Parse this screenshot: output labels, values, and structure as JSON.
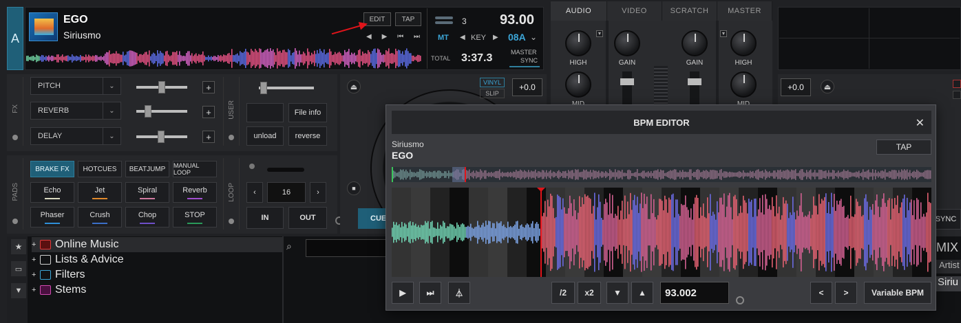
{
  "deck": {
    "letter": "A",
    "title": "EGO",
    "artist": "Siriusmo",
    "edit_label": "EDIT",
    "tap_label": "TAP",
    "bpm": "93.00",
    "beat_count": "3",
    "mt_label": "MT",
    "key_label": "KEY",
    "key_value": "08A",
    "total_label": "TOTAL",
    "total_time": "3:37.3",
    "master_label": "MASTER",
    "sync_label": "SYNC"
  },
  "mixer": {
    "tabs": [
      "AUDIO",
      "VIDEO",
      "SCRATCH",
      "MASTER"
    ],
    "high_label": "HIGH",
    "mid_label": "MID",
    "gain_label": "GAIN"
  },
  "fx": {
    "side_label": "FX",
    "effects": [
      "PITCH",
      "REVERB",
      "DELAY"
    ],
    "user_label": "USER",
    "file_info": "File info",
    "unload": "unload",
    "reverse": "reverse"
  },
  "pads": {
    "side_label": "PADS",
    "tabs": [
      "BRAKE FX",
      "HOTCUES",
      "BEATJUMP",
      "MANUAL LOOP"
    ],
    "buttons": [
      {
        "label": "Echo",
        "color": "#d9d9c0"
      },
      {
        "label": "Jet",
        "color": "#e08a2c"
      },
      {
        "label": "Spiral",
        "color": "#d07aa0"
      },
      {
        "label": "Reverb",
        "color": "#a24fd0"
      },
      {
        "label": "Phaser",
        "color": "#2f8fd8"
      },
      {
        "label": "Crush",
        "color": "#3b6fc8"
      },
      {
        "label": "Chop",
        "color": "#6e4fc8"
      },
      {
        "label": "STOP",
        "color": "#2a9a5a"
      }
    ],
    "loop_label": "LOOP",
    "loop_size": "16",
    "in_label": "IN",
    "out_label": "OUT"
  },
  "turntable": {
    "vinyl": "VINYL",
    "slip": "SLIP",
    "pitch_value": "+0.0",
    "cue_label": "CUE",
    "right_pitch_value": "+0.0",
    "right_sync": "SYNC"
  },
  "browser": {
    "items": [
      {
        "label": "Online Music",
        "color": "#e03a3a"
      },
      {
        "label": "Lists & Advice",
        "color": "#d0d0d0"
      },
      {
        "label": "Filters",
        "color": "#3ca6d8"
      },
      {
        "label": "Stems",
        "color": "#d04ab0"
      }
    ],
    "search_placeholder": "",
    "right_header": "MIX",
    "right_col": "Artist",
    "right_cell": "Siriu"
  },
  "bpm_editor": {
    "title": "BPM EDITOR",
    "artist": "Siriusmo",
    "track": "EGO",
    "tap_label": "TAP",
    "half_label": "/2",
    "double_label": "x2",
    "bpm_value": "93.002",
    "prev_label": "<",
    "next_label": ">",
    "variable_label": "Variable BPM"
  }
}
